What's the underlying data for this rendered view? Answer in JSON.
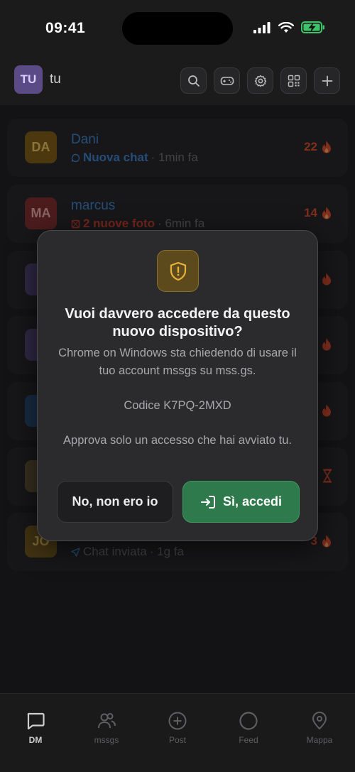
{
  "status": {
    "time": "09:41"
  },
  "header": {
    "avatar_initials": "TU",
    "username": "tu"
  },
  "conversations": [
    {
      "initials": "DA",
      "name": "Dani",
      "status": "Nuova chat",
      "time": "· 1min fa",
      "streak": "22",
      "avatar_bg": "#7a5a12",
      "avatar_fg": "#e7c25a",
      "status_color": "#3c7fc7"
    },
    {
      "initials": "MA",
      "name": "marcus",
      "status": "2 nuove foto",
      "time": "· 6min fa",
      "streak": "14",
      "avatar_bg": "#7c2a2a",
      "avatar_fg": "#e5a5a5",
      "status_color": "#c0392b"
    },
    {
      "initials": "JO",
      "status": "Chat inviata",
      "time": "· 1g fa",
      "streak": "3",
      "avatar_bg": "#6b5318",
      "avatar_fg": "#d9b45a",
      "status_color": "#3c7fc7"
    }
  ],
  "nav": [
    {
      "label": "DM",
      "icon": "chat-icon"
    },
    {
      "label": "mssgs",
      "icon": "people-icon"
    },
    {
      "label": "Post",
      "icon": "add-circle-icon"
    },
    {
      "label": "Feed",
      "icon": "circle-icon"
    },
    {
      "label": "Mappa",
      "icon": "map-pin-icon"
    }
  ],
  "modal": {
    "icon": "shield-alert-icon",
    "title": "Vuoi davvero accedere da questo nuovo dispositivo?",
    "description": "Chrome on Windows sta chiedendo di usare il tuo account mssgs su mss.gs.",
    "code": "Codice K7PQ-2MXD",
    "warning": "Approva solo un accesso che hai avviato tu.",
    "deny_label": "No, non ero io",
    "approve_label": "Sì, accedi"
  },
  "colors": {
    "accent_green": "#2f7a4c",
    "streak": "#d9492a",
    "warning": "#e8b23a"
  }
}
